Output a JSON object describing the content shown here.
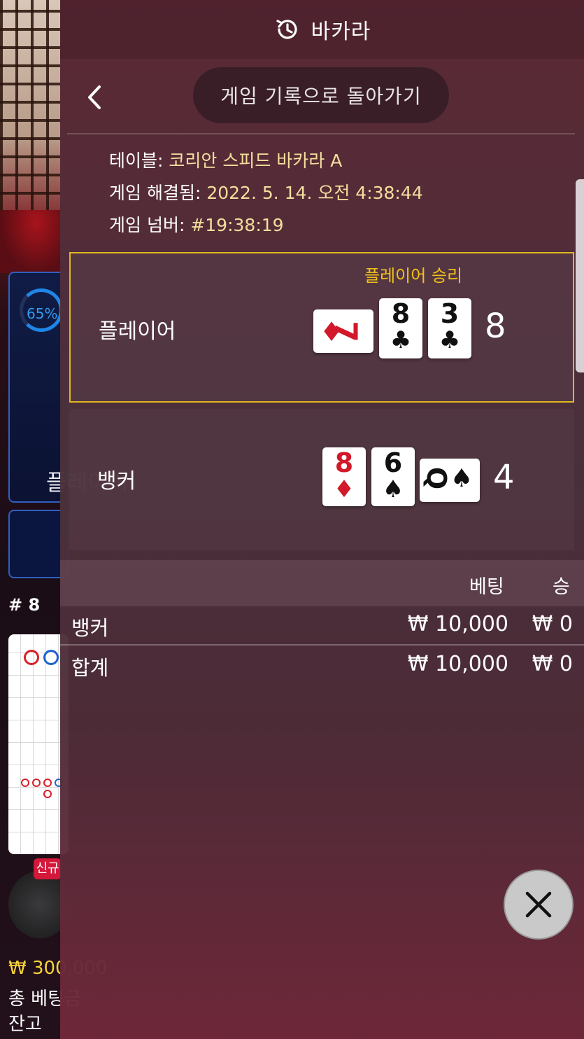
{
  "header": {
    "title": "바카라",
    "icon": "history-icon"
  },
  "nav": {
    "back_icon": "chevron-left-icon",
    "back_to_history_label": "게임 기록으로 돌아가기"
  },
  "details": {
    "table_key": "테이블:",
    "table_value": "코리안 스피드 바카라 A",
    "resolved_key": "게임 해결됨:",
    "resolved_value": "2022. 5. 14. 오전 4:38:44",
    "number_key": "게임 넘버:",
    "number_value": "#19:38:19"
  },
  "result": {
    "player": {
      "label": "플레이어",
      "win_label": "플레이어 승리",
      "score": "8",
      "cards": [
        {
          "rank": "7",
          "suit": "♦",
          "color": "red",
          "rotated": true
        },
        {
          "rank": "8",
          "suit": "♣",
          "color": "black",
          "rotated": false
        },
        {
          "rank": "3",
          "suit": "♣",
          "color": "black",
          "rotated": false
        }
      ]
    },
    "banker": {
      "label": "뱅커",
      "score": "4",
      "cards": [
        {
          "rank": "8",
          "suit": "♦",
          "color": "red",
          "rotated": false
        },
        {
          "rank": "6",
          "suit": "♠",
          "color": "black",
          "rotated": false
        },
        {
          "rank": "Q",
          "suit": "♠",
          "color": "black",
          "rotated": true
        }
      ]
    }
  },
  "bets": {
    "columns": [
      "베팅",
      "승"
    ],
    "rows": [
      {
        "name": "뱅커",
        "bet": "₩ 10,000",
        "win": "₩ 0"
      },
      {
        "name": "합계",
        "bet": "₩ 10,000",
        "win": "₩ 0"
      }
    ]
  },
  "close_icon": "close-icon",
  "background": {
    "percent": "65%",
    "player_label": "플레이어",
    "round": "# 8",
    "new_badge": "신규",
    "balance": "₩ 300,000",
    "total_bet": "총 베팅금",
    "remaining": "잔고"
  }
}
